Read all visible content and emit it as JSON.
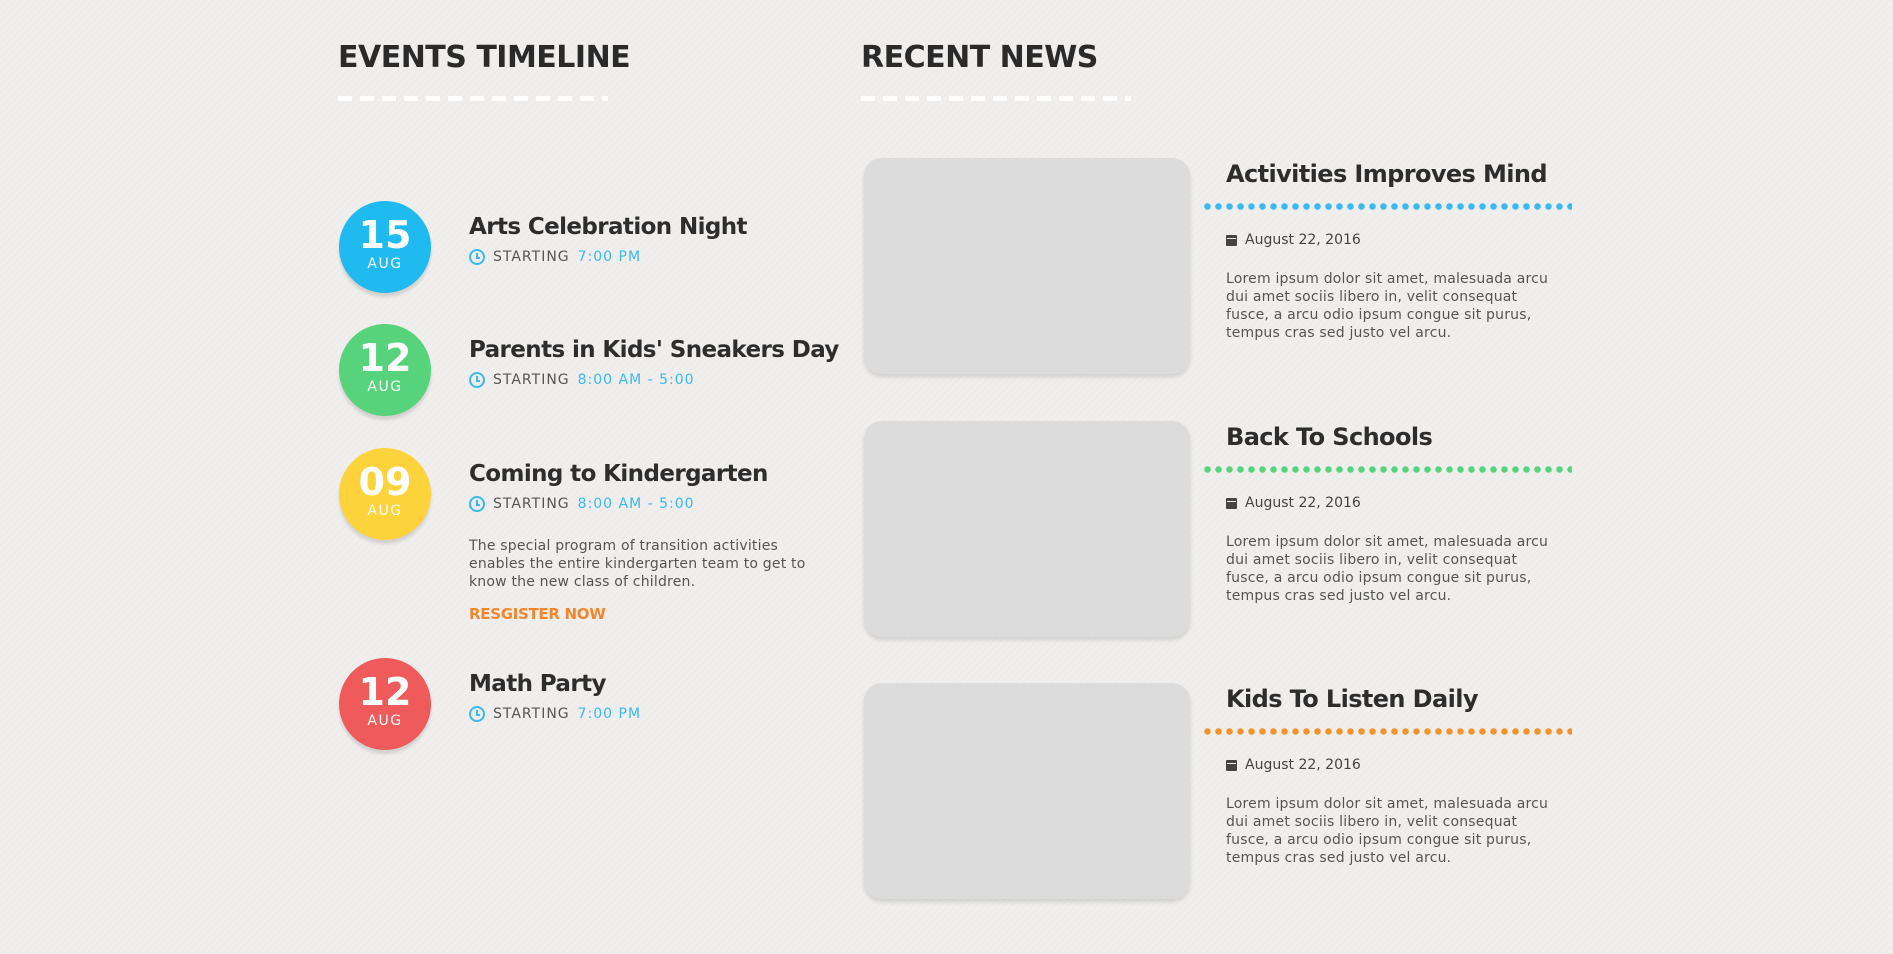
{
  "events_section": {
    "title": "EVENTS TIMELINE",
    "events": [
      {
        "day": "15",
        "month": "AUG",
        "color": "#1fbaf0",
        "title": "Arts Celebration Night",
        "starting_label": "STARTING",
        "time": "7:00 PM"
      },
      {
        "day": "12",
        "month": "AUG",
        "color": "#57d37b",
        "title": "Parents in Kids' Sneakers Day",
        "starting_label": "STARTING",
        "time": "8:00 AM - 5:00"
      },
      {
        "day": "09",
        "month": "AUG",
        "color": "#fdd33b",
        "title": "Coming to Kindergarten",
        "starting_label": "STARTING",
        "time": "8:00 AM - 5:00",
        "description": "The special program of transition activities enables the entire kindergarten team to get to know the new class of children.",
        "register_label": "RESGISTER NOW"
      },
      {
        "day": "12",
        "month": "AUG",
        "color": "#ef5a5a",
        "title": "Math Party",
        "starting_label": "STARTING",
        "time": "7:00 PM"
      }
    ]
  },
  "news_section": {
    "title": "RECENT NEWS",
    "items": [
      {
        "title": "Activities Improves Mind",
        "dot_color": "#3bb9ee",
        "date": "August 22, 2016",
        "text": "Lorem ipsum dolor sit amet, malesuada arcu dui amet sociis libero in, velit consequat fusce, a arcu odio ipsum congue sit purus, tempus cras sed justo vel arcu."
      },
      {
        "title": "Back To Schools",
        "dot_color": "#57d37b",
        "date": "August 22, 2016",
        "text": "Lorem ipsum dolor sit amet, malesuada arcu dui amet sociis libero in, velit consequat fusce, a arcu odio ipsum congue sit purus, tempus cras sed justo vel arcu."
      },
      {
        "title": "Kids To Listen Daily",
        "dot_color": "#f2932f",
        "date": "August 22, 2016",
        "text": "Lorem ipsum dolor sit amet, malesuada arcu dui amet sociis libero in, velit consequat fusce, a arcu odio ipsum congue sit purus, tempus cras sed justo vel arcu."
      }
    ]
  }
}
